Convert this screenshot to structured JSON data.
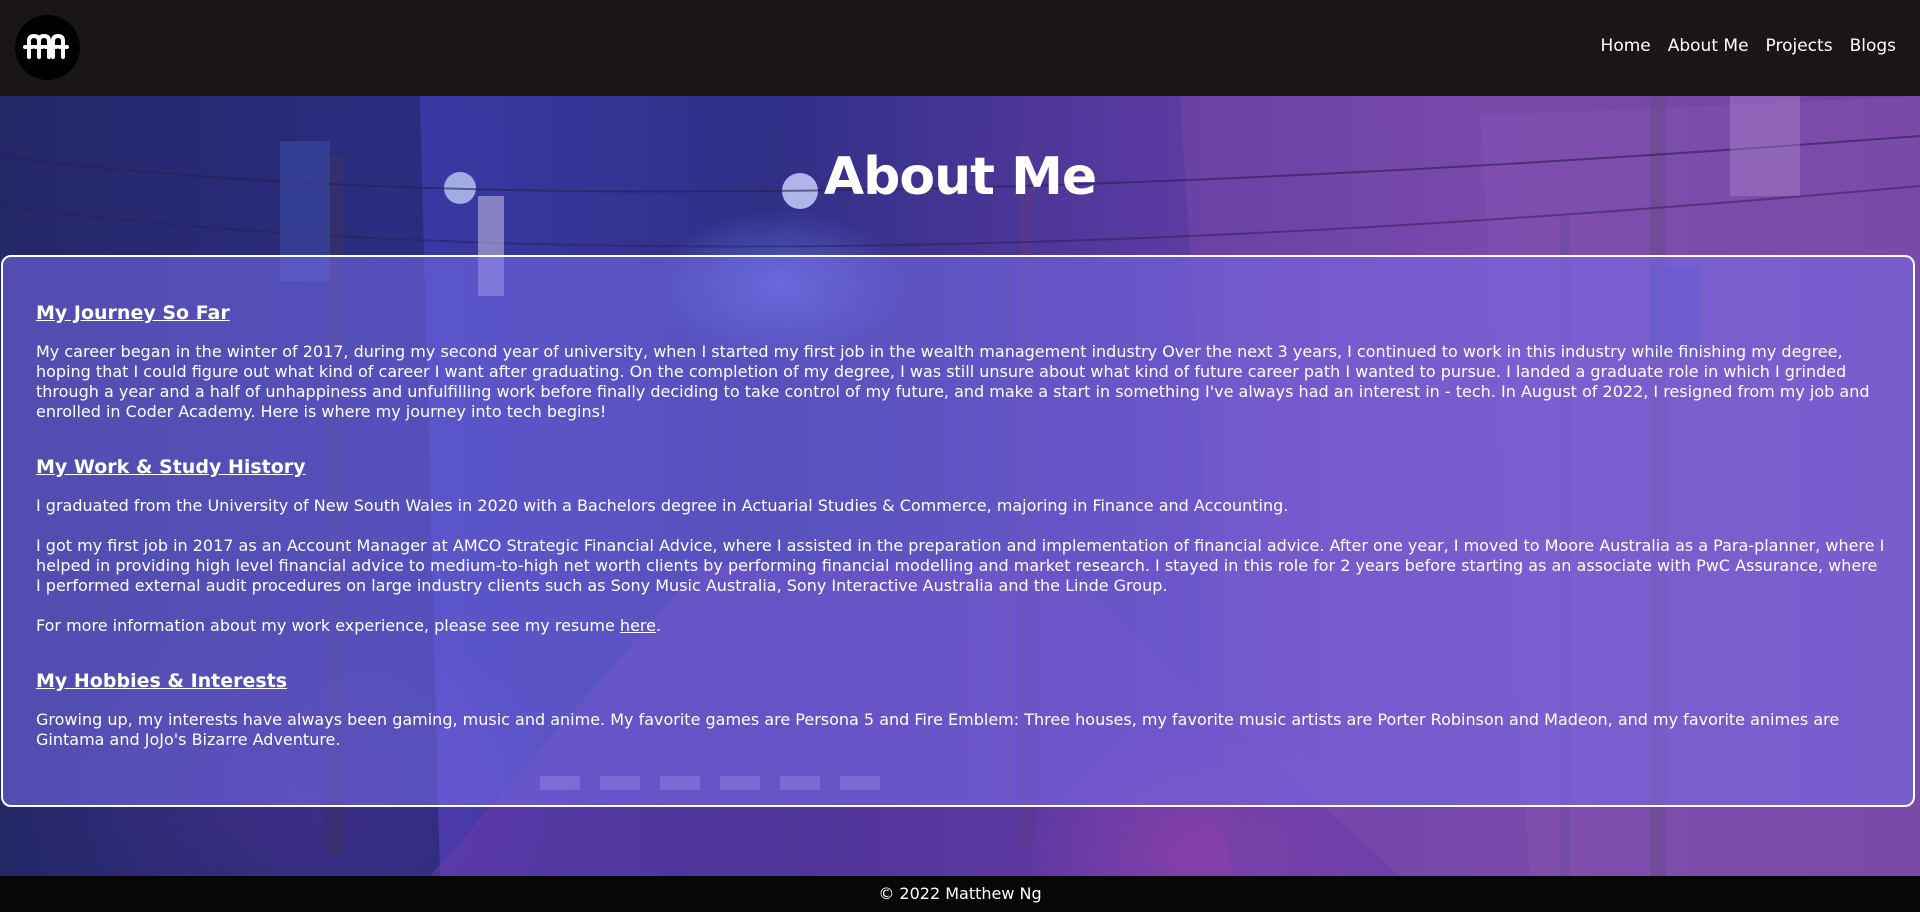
{
  "header": {
    "logo_text": "mn",
    "nav": [
      {
        "label": "Home"
      },
      {
        "label": "About Me"
      },
      {
        "label": "Projects"
      },
      {
        "label": "Blogs"
      }
    ]
  },
  "page_title": "About Me",
  "sections": {
    "journey": {
      "heading": "My Journey So Far",
      "paragraph": "My career began in the winter of 2017, during my second year of university, when I started my first job in the wealth management industry Over the next 3 years, I continued to work in this industry while finishing my degree, hoping that I could figure out what kind of career I want after graduating. On the completion of my degree, I was still unsure about what kind of future career path I wanted to pursue. I landed a graduate role in which I grinded through a year and a half of unhappiness and unfulfilling work before finally deciding to take control of my future, and make a start in something I've always had an interest in - tech. In August of 2022, I resigned from my job and enrolled in Coder Academy. Here is where my journey into tech begins!"
    },
    "work": {
      "heading": "My Work & Study History",
      "paragraph1": "I graduated from the University of New South Wales in 2020 with a Bachelors degree in Actuarial Studies & Commerce, majoring in Finance and Accounting.",
      "paragraph2": "I got my first job in 2017 as an Account Manager at AMCO Strategic Financial Advice, where I assisted in the preparation and implementation of financial advice. After one year, I moved to Moore Australia as a Para-planner, where I helped in providing high level financial advice to medium-to-high net worth clients by performing financial modelling and market research. I stayed in this role for 2 years before starting as an associate with PwC Assurance, where I performed external audit procedures on large industry clients such as Sony Music Australia, Sony Interactive Australia and the Linde Group.",
      "paragraph3_prefix": "For more information about my work experience, please see my resume ",
      "resume_link": "here",
      "paragraph3_suffix": "."
    },
    "hobbies": {
      "heading": "My Hobbies & Interests",
      "paragraph": "Growing up, my interests have always been gaming, music and anime. My favorite games are Persona 5 and Fire Emblem: Three houses, my favorite music artists are Porter Robinson and Madeon, and my favorite animes are Gintama and JoJo's Bizarre Adventure."
    }
  },
  "footer": {
    "text": "© 2022 Matthew Ng"
  },
  "colors": {
    "header_bg": "#1a1616",
    "footer_bg": "#070707",
    "card_bg": "rgba(120,110,235,0.55)",
    "text": "#ffffff"
  }
}
